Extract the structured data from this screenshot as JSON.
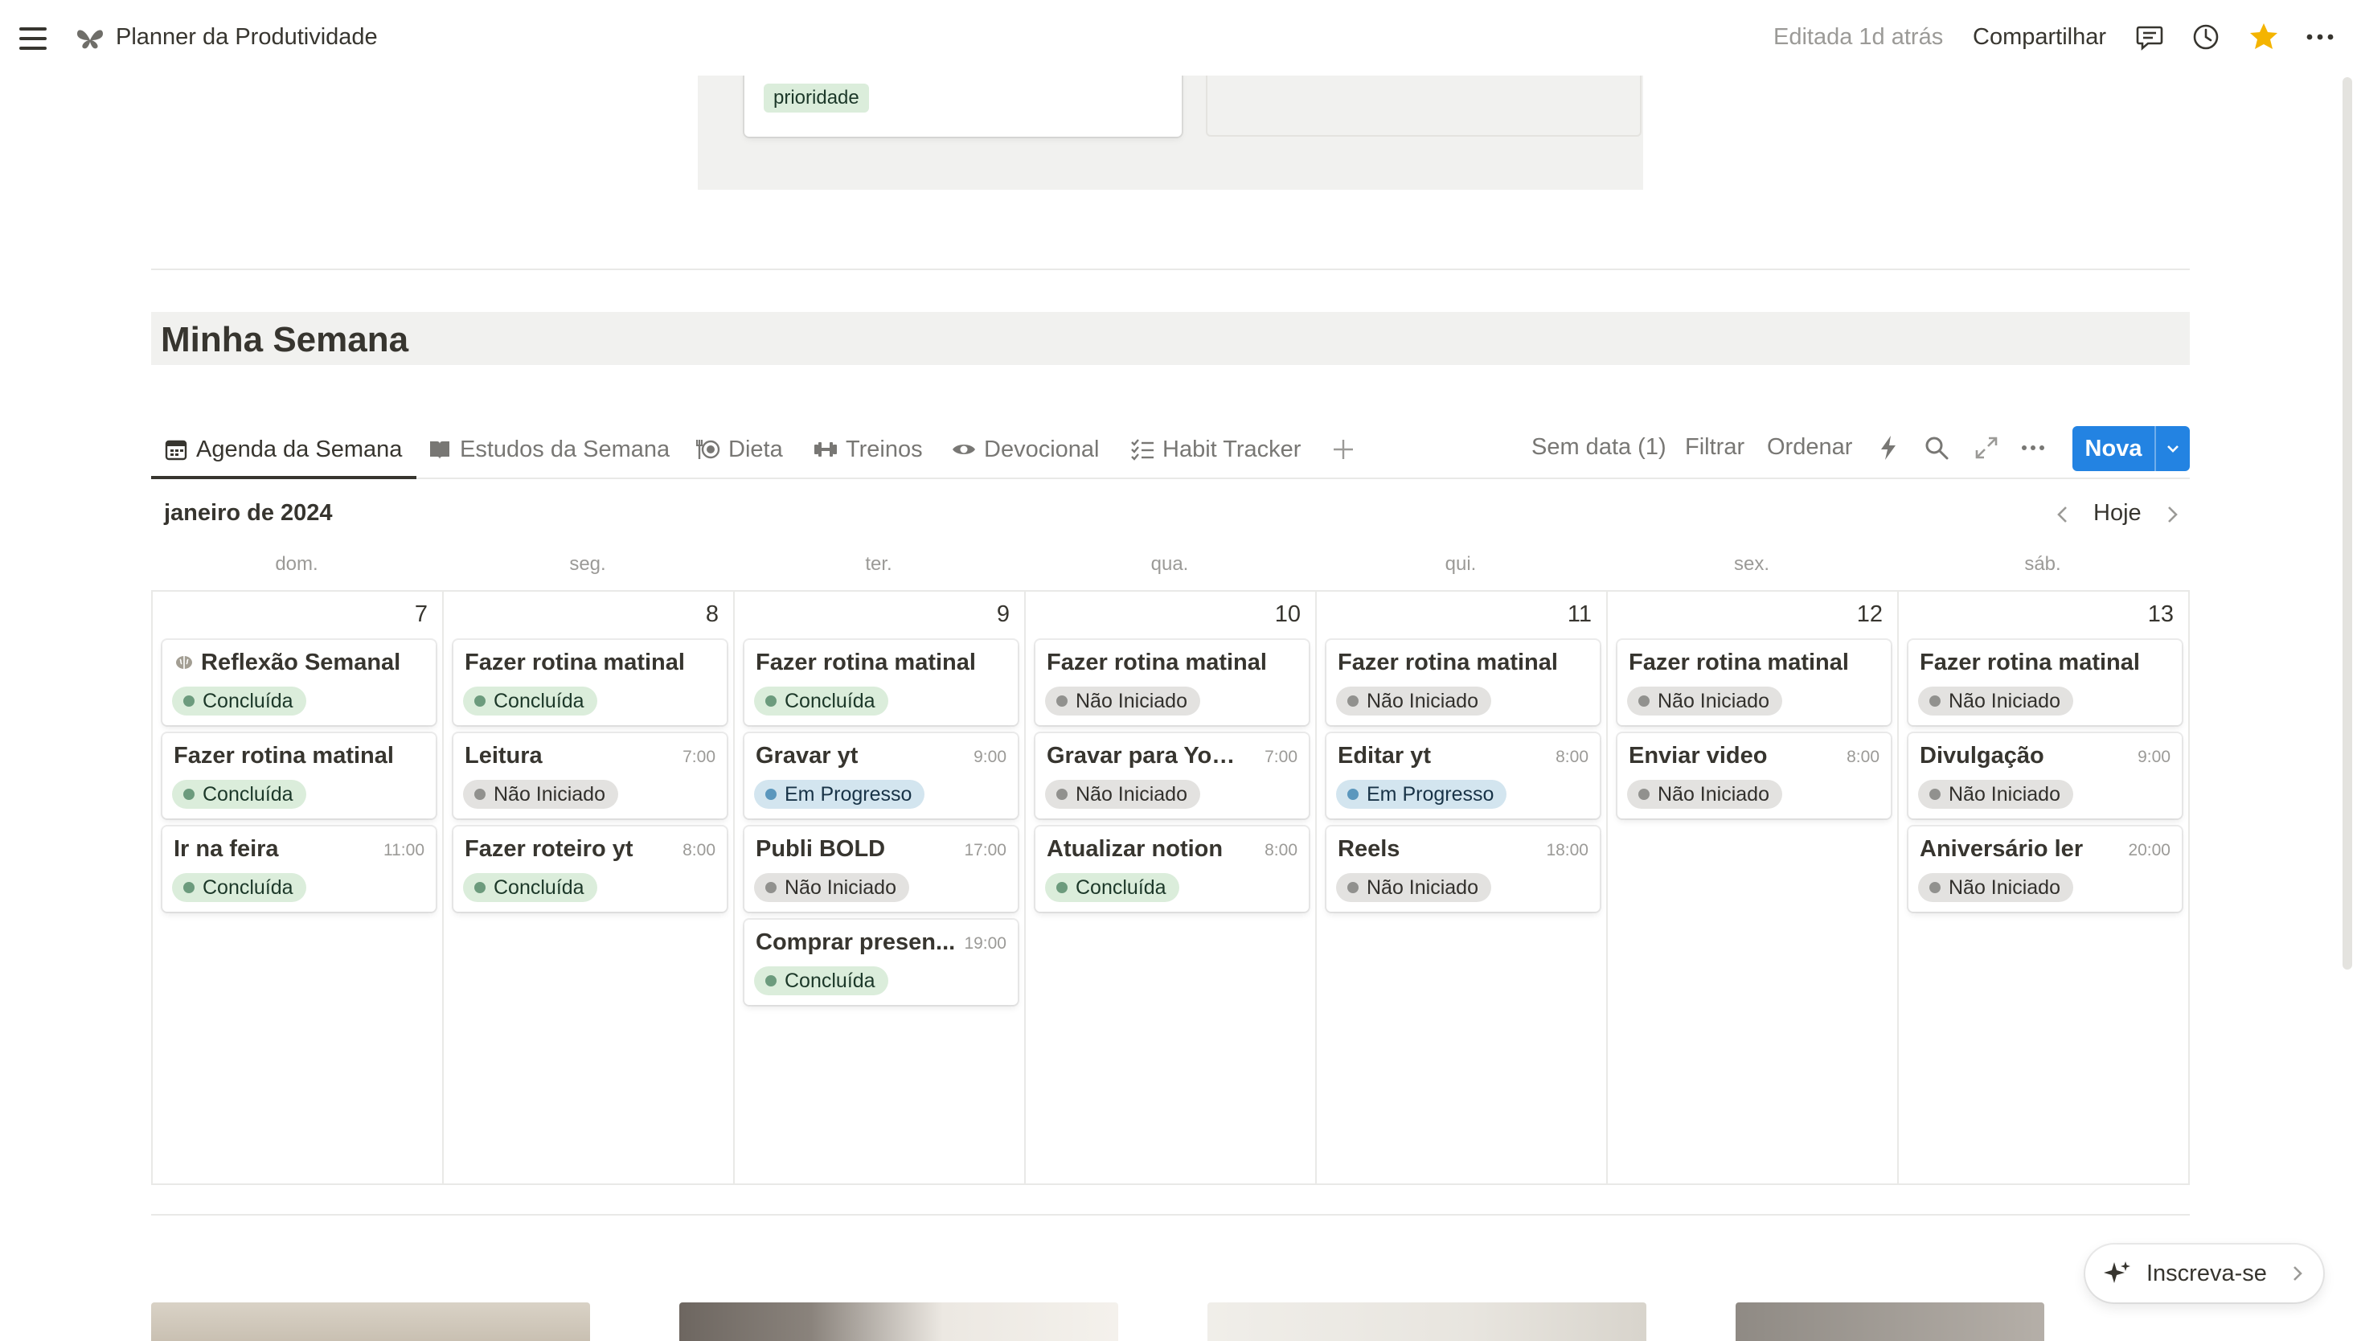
{
  "topbar": {
    "page_title": "Planner da Produtividade",
    "page_icon": "butterfly-icon",
    "edited": "Editada 1d atrás",
    "share": "Compartilhar",
    "favorite_color": "#f4b400"
  },
  "gallery": {
    "tag": "prioridade"
  },
  "section": {
    "title": "Minha Semana"
  },
  "tabs": [
    {
      "label": "Agenda da Semana",
      "icon": "calendar-icon"
    },
    {
      "label": "Estudos da Semana",
      "icon": "book-icon"
    },
    {
      "label": "Dieta",
      "icon": "cutlery-icon"
    },
    {
      "label": "Treinos",
      "icon": "dumbbell-icon"
    },
    {
      "label": "Devocional",
      "icon": "eye-icon"
    },
    {
      "label": "Habit Tracker",
      "icon": "checklist-icon"
    }
  ],
  "toolbar": {
    "no_date": "Sem data (1)",
    "filter": "Filtrar",
    "sort": "Ordenar",
    "new": "Nova",
    "accent": "#2383e2"
  },
  "calendar": {
    "month": "janeiro de 2024",
    "today": "Hoje",
    "weekdays": [
      "dom.",
      "seg.",
      "ter.",
      "qua.",
      "qui.",
      "sex.",
      "sáb."
    ],
    "days": [
      {
        "num": "7",
        "events": [
          {
            "title": "Reflexão Semanal",
            "time": "",
            "status": "Concluída",
            "kind": "done"
          },
          {
            "title": "Fazer rotina matinal",
            "time": "",
            "status": "Concluída",
            "kind": "done"
          },
          {
            "title": "Ir na feira",
            "time": "11:00",
            "status": "Concluída",
            "kind": "done"
          }
        ]
      },
      {
        "num": "8",
        "events": [
          {
            "title": "Fazer rotina matinal",
            "time": "",
            "status": "Concluída",
            "kind": "done"
          },
          {
            "title": "Leitura",
            "time": "7:00",
            "status": "Não Iniciado",
            "kind": "not"
          },
          {
            "title": "Fazer roteiro yt",
            "time": "8:00",
            "status": "Concluída",
            "kind": "done"
          }
        ]
      },
      {
        "num": "9",
        "events": [
          {
            "title": "Fazer rotina matinal",
            "time": "",
            "status": "Concluída",
            "kind": "done"
          },
          {
            "title": "Gravar yt",
            "time": "9:00",
            "status": "Em Progresso",
            "kind": "prog"
          },
          {
            "title": "Publi BOLD",
            "time": "17:00",
            "status": "Não Iniciado",
            "kind": "not"
          },
          {
            "title": "Comprar presen...",
            "time": "19:00",
            "status": "Concluída",
            "kind": "done"
          }
        ]
      },
      {
        "num": "10",
        "events": [
          {
            "title": "Fazer rotina matinal",
            "time": "",
            "status": "Não Iniciado",
            "kind": "not"
          },
          {
            "title": "Gravar para Yout...",
            "time": "7:00",
            "status": "Não Iniciado",
            "kind": "not"
          },
          {
            "title": "Atualizar notion",
            "time": "8:00",
            "status": "Concluída",
            "kind": "done"
          }
        ]
      },
      {
        "num": "11",
        "events": [
          {
            "title": "Fazer rotina matinal",
            "time": "",
            "status": "Não Iniciado",
            "kind": "not"
          },
          {
            "title": "Editar yt",
            "time": "8:00",
            "status": "Em Progresso",
            "kind": "prog"
          },
          {
            "title": "Reels",
            "time": "18:00",
            "status": "Não Iniciado",
            "kind": "not"
          }
        ]
      },
      {
        "num": "12",
        "events": [
          {
            "title": "Fazer rotina matinal",
            "time": "",
            "status": "Não Iniciado",
            "kind": "not"
          },
          {
            "title": "Enviar video",
            "time": "8:00",
            "status": "Não Iniciado",
            "kind": "not"
          }
        ]
      },
      {
        "num": "13",
        "events": [
          {
            "title": "Fazer rotina matinal",
            "time": "",
            "status": "Não Iniciado",
            "kind": "not"
          },
          {
            "title": "Divulgação",
            "time": "9:00",
            "status": "Não Iniciado",
            "kind": "not"
          },
          {
            "title": "Aniversário ler",
            "time": "20:00",
            "status": "Não Iniciado",
            "kind": "not"
          }
        ]
      }
    ]
  },
  "subscribe": {
    "label": "Inscreva-se"
  }
}
